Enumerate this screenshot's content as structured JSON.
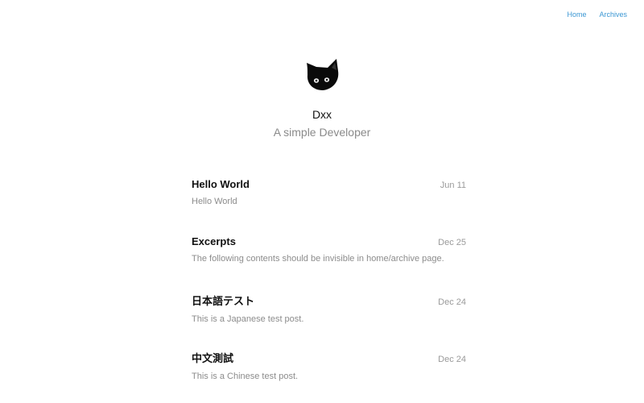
{
  "nav": {
    "links": [
      "Home",
      "Archives"
    ]
  },
  "profile": {
    "avatar_icon": "black-cat-icon",
    "name": "Dxx",
    "description": "A simple Developer"
  },
  "posts": [
    {
      "title": "Hello World",
      "date": "Jun 11",
      "excerpt": "Hello World"
    },
    {
      "title": "Excerpts",
      "date": "Dec 25",
      "excerpt": "The following contents should be invisible in home/archive page."
    },
    {
      "title": "日本語テスト",
      "date": "Dec 24",
      "excerpt": "This is a Japanese test post."
    },
    {
      "title": "中文測試",
      "date": "Dec 24",
      "excerpt": "This is a Chinese test post."
    }
  ],
  "colors": {
    "link": "#3b97d3",
    "muted_text": "#8a8a8a",
    "title_text": "#111111"
  }
}
